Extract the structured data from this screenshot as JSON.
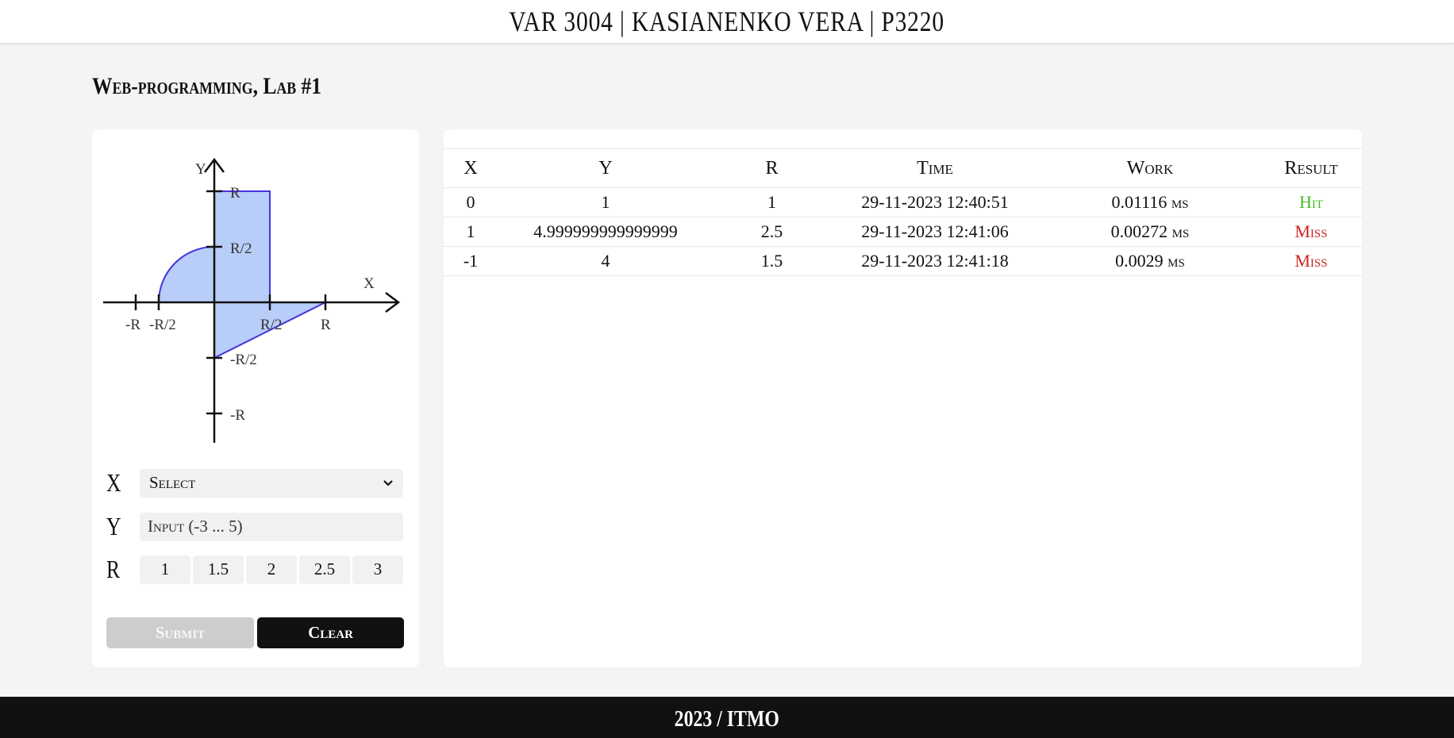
{
  "header": {
    "title": "VAR 3004 | KASIANENKO VERA | P3220"
  },
  "lab_title": "Web-programming, Lab #1",
  "graph": {
    "axis_x_label": "X",
    "axis_y_label": "Y",
    "x_ticks": [
      "-R",
      "-R/2",
      "R/2",
      "R"
    ],
    "y_ticks": [
      "R",
      "R/2",
      "-R/2",
      "-R"
    ],
    "area_fill": "#b8cdf7",
    "area_stroke": "#4433dd"
  },
  "form": {
    "x": {
      "label": "X",
      "selected": "Select"
    },
    "y": {
      "label": "Y",
      "placeholder": "Input (-3 ... 5)"
    },
    "r": {
      "label": "R",
      "options": [
        "1",
        "1.5",
        "2",
        "2.5",
        "3"
      ]
    },
    "submit_label": "Submit",
    "clear_label": "Clear"
  },
  "table": {
    "headers": [
      "X",
      "Y",
      "R",
      "Time",
      "Work",
      "Result"
    ],
    "rows": [
      {
        "x": "0",
        "y": "1",
        "r": "1",
        "time": "29-11-2023 12:40:51",
        "work": "0.01116",
        "unit": "ms",
        "result": "Hit"
      },
      {
        "x": "1",
        "y": "4.999999999999999",
        "r": "2.5",
        "time": "29-11-2023 12:41:06",
        "work": "0.00272",
        "unit": "ms",
        "result": "Miss"
      },
      {
        "x": "-1",
        "y": "4",
        "r": "1.5",
        "time": "29-11-2023 12:41:18",
        "work": "0.0029",
        "unit": "ms",
        "result": "Miss"
      }
    ]
  },
  "colors": {
    "hit": "#44bb22",
    "miss": "#cc2222"
  },
  "footer": {
    "text": "2023 / ITMO"
  }
}
